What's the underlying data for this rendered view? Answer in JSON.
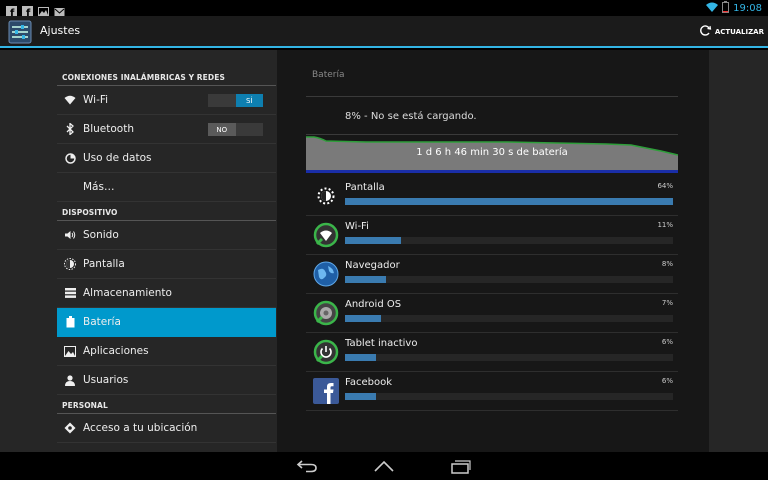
{
  "status_bar": {
    "notification_icons": [
      "facebook-icon",
      "facebook-icon",
      "image-icon",
      "mail-icon"
    ],
    "time": "19:08",
    "battery_percent": 8,
    "accent_color": "#33b5e5"
  },
  "action_bar": {
    "title": "Ajustes",
    "refresh_label": "ACTUALIZAR"
  },
  "left_panel": {
    "sections": [
      {
        "header": "CONEXIONES INALÁMBRICAS Y REDES",
        "items": [
          {
            "label": "Wi-Fi",
            "icon": "wifi-icon",
            "toggle": "SÍ"
          },
          {
            "label": "Bluetooth",
            "icon": "bluetooth-icon",
            "toggle": "NO"
          },
          {
            "label": "Uso de datos",
            "icon": "data-usage-icon"
          },
          {
            "label": "Más…"
          }
        ]
      },
      {
        "header": "DISPOSITIVO",
        "items": [
          {
            "label": "Sonido",
            "icon": "sound-icon"
          },
          {
            "label": "Pantalla",
            "icon": "display-icon"
          },
          {
            "label": "Almacenamiento",
            "icon": "storage-icon"
          },
          {
            "label": "Batería",
            "icon": "battery-icon",
            "selected": true
          },
          {
            "label": "Aplicaciones",
            "icon": "apps-icon"
          },
          {
            "label": "Usuarios",
            "icon": "users-icon"
          }
        ]
      },
      {
        "header": "PERSONAL",
        "items": [
          {
            "label": "Acceso a tu ubicación",
            "icon": "location-icon"
          }
        ]
      }
    ]
  },
  "battery_panel": {
    "title": "Batería",
    "status": "8% - No se está cargando.",
    "graph_label": "1 d 6 h 46 min 30 s de batería",
    "graph_colors": {
      "fill": "#7a7a7a",
      "line": "#2e9e3a",
      "base": "#1a2ea8"
    },
    "apps": [
      {
        "name": "Pantalla",
        "percent_text": "64%",
        "percent": 64,
        "icon": "screen-brightness-icon"
      },
      {
        "name": "Wi-Fi",
        "percent_text": "11%",
        "percent": 11,
        "icon": "wifi-app-icon"
      },
      {
        "name": "Navegador",
        "percent_text": "8%",
        "percent": 8,
        "icon": "browser-globe-icon"
      },
      {
        "name": "Android OS",
        "percent_text": "7%",
        "percent": 7,
        "icon": "android-os-icon"
      },
      {
        "name": "Tablet inactivo",
        "percent_text": "6%",
        "percent": 6,
        "icon": "power-icon"
      },
      {
        "name": "Facebook",
        "percent_text": "6%",
        "percent": 6,
        "icon": "facebook-app-icon"
      }
    ],
    "bar_color": "#3a7bb0"
  },
  "nav_bar": {
    "buttons": [
      "back-icon",
      "home-icon",
      "recent-apps-icon"
    ]
  }
}
